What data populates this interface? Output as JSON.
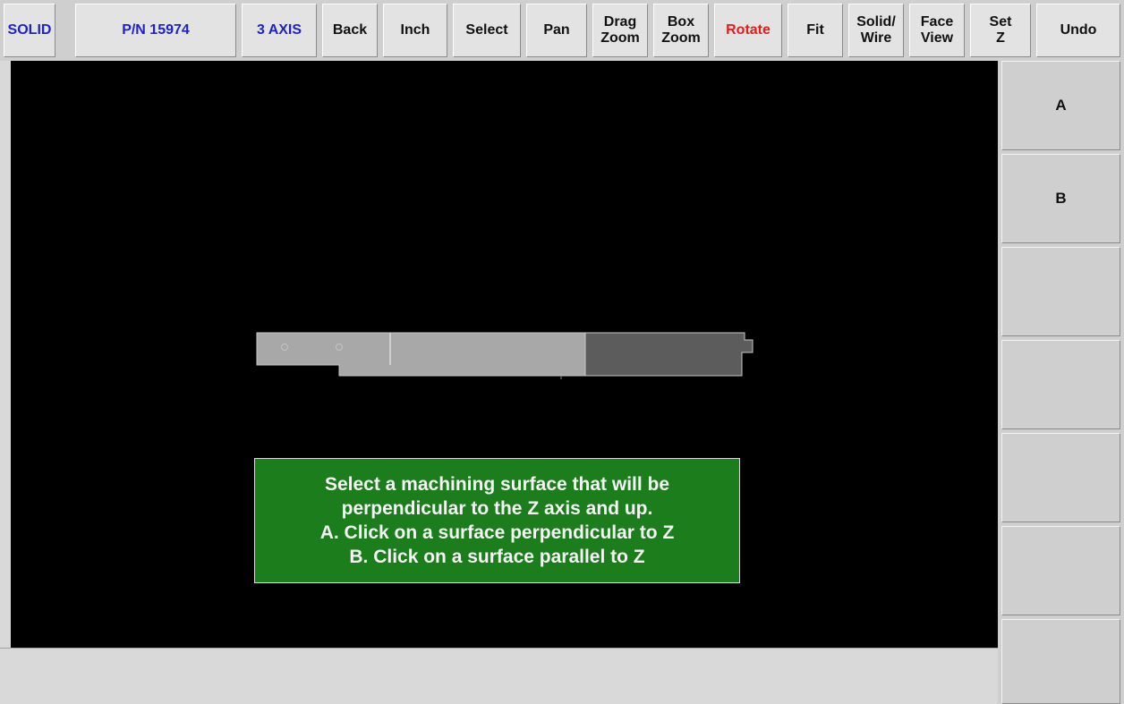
{
  "toolbar": {
    "mode": "SOLID",
    "part_number": "P/N 15974",
    "axis": "3 AXIS",
    "back": "Back",
    "units": "Inch",
    "select": "Select",
    "pan": "Pan",
    "drag_zoom": "Drag\nZoom",
    "box_zoom": "Box\nZoom",
    "rotate": "Rotate",
    "fit": "Fit",
    "solid_wire": "Solid/\nWire",
    "face_view": "Face\nView",
    "set_z": "Set\nZ",
    "undo": "Undo"
  },
  "side_panel": {
    "option_a": "A",
    "option_b": "B"
  },
  "prompt": {
    "line1": "Select a machining surface that will be",
    "line2": "perpendicular to the Z axis and up.",
    "line3": "A. Click on a surface perpendicular to Z",
    "line4": "B. Click on a surface parallel to Z"
  },
  "colors": {
    "toolbar_text_blue": "#1f22c6",
    "rotate_active_red": "#e51c1c",
    "prompt_green": "#1c7d1c",
    "viewport_black": "#000000",
    "part_light": "#a8a8a8",
    "part_dark": "#5c5c5c"
  }
}
